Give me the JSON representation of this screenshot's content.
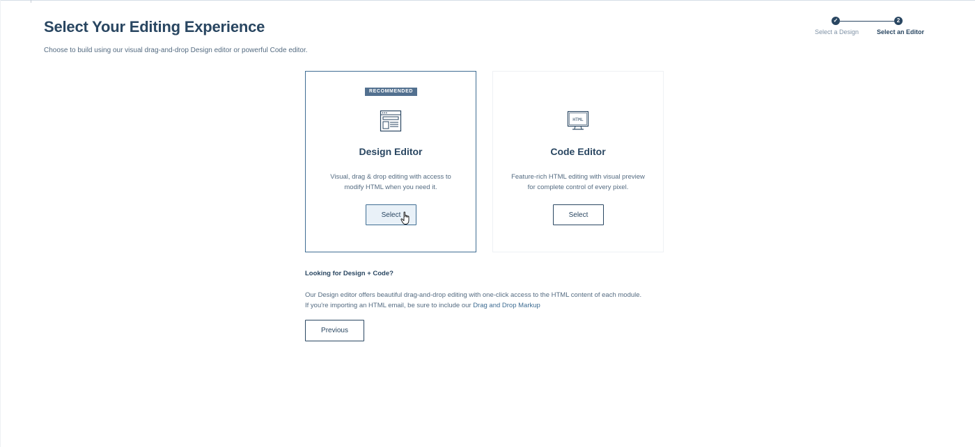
{
  "header": {
    "title": "Select Your Editing Experience",
    "subtitle": "Choose to build using our visual drag-and-drop Design editor or powerful Code editor."
  },
  "stepper": {
    "steps": [
      {
        "number": "✓",
        "label": "Select a Design",
        "status": "complete"
      },
      {
        "number": "2",
        "label": "Select an Editor",
        "status": "current"
      }
    ]
  },
  "cards": {
    "design": {
      "badge": "RECOMMENDED",
      "icon": "design-layout-icon",
      "title": "Design Editor",
      "description": "Visual, drag & drop editing with access to modify HTML when you need it.",
      "button_label": "Select"
    },
    "code": {
      "icon": "html-monitor-icon",
      "icon_text": "HTML",
      "title": "Code Editor",
      "description": "Feature-rich HTML editing with visual preview for complete control of every pixel.",
      "button_label": "Select"
    }
  },
  "info": {
    "heading": "Looking for Design + Code?",
    "line1": "Our Design editor offers beautiful drag-and-drop editing with one-click access to the HTML content of each module.",
    "line2_prefix": "If you're importing an HTML email, be sure to include our ",
    "link_text": "Drag and Drop Markup"
  },
  "footer": {
    "previous_label": "Previous"
  },
  "colors": {
    "primary": "#294661",
    "accent": "#3e6c92",
    "muted_text": "#546b81",
    "badge_bg": "#52708f"
  }
}
